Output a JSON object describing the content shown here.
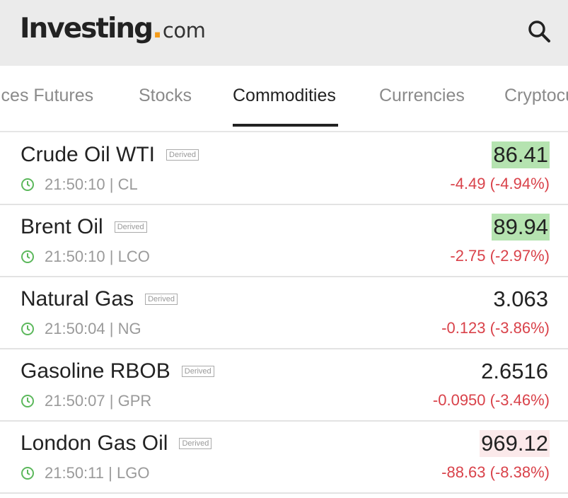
{
  "header": {
    "logo_main": "Investing",
    "logo_suffix": "com",
    "search_icon": "search-icon"
  },
  "tabs": [
    {
      "label": "ices Futures",
      "active": false
    },
    {
      "label": "Stocks",
      "active": false
    },
    {
      "label": "Commodities",
      "active": true
    },
    {
      "label": "Currencies",
      "active": false
    },
    {
      "label": "Cryptocu",
      "active": false
    }
  ],
  "commodities": [
    {
      "name": "Crude Oil WTI",
      "badge": "Derived",
      "time": "21:50:10",
      "symbol": "CL",
      "price": "86.41",
      "change": "-4.49 (-4.94%)",
      "highlight": "green"
    },
    {
      "name": "Brent Oil",
      "badge": "Derived",
      "time": "21:50:10",
      "symbol": "LCO",
      "price": "89.94",
      "change": "-2.75 (-2.97%)",
      "highlight": "green"
    },
    {
      "name": "Natural Gas",
      "badge": "Derived",
      "time": "21:50:04",
      "symbol": "NG",
      "price": "3.063",
      "change": "-0.123 (-3.86%)",
      "highlight": "none"
    },
    {
      "name": "Gasoline RBOB",
      "badge": "Derived",
      "time": "21:50:07",
      "symbol": "GPR",
      "price": "2.6516",
      "change": "-0.0950 (-3.46%)",
      "highlight": "none"
    },
    {
      "name": "London Gas Oil",
      "badge": "Derived",
      "time": "21:50:11",
      "symbol": "LGO",
      "price": "969.12",
      "change": "-88.63 (-8.38%)",
      "highlight": "pink"
    }
  ],
  "colors": {
    "header_bg": "#ebebeb",
    "brand_orange": "#f59c1a",
    "price_up_highlight": "#b5e3b0",
    "price_flash_pink": "#fbe9ea",
    "change_negative": "#d9424a",
    "clock_icon": "#5cb85c"
  }
}
